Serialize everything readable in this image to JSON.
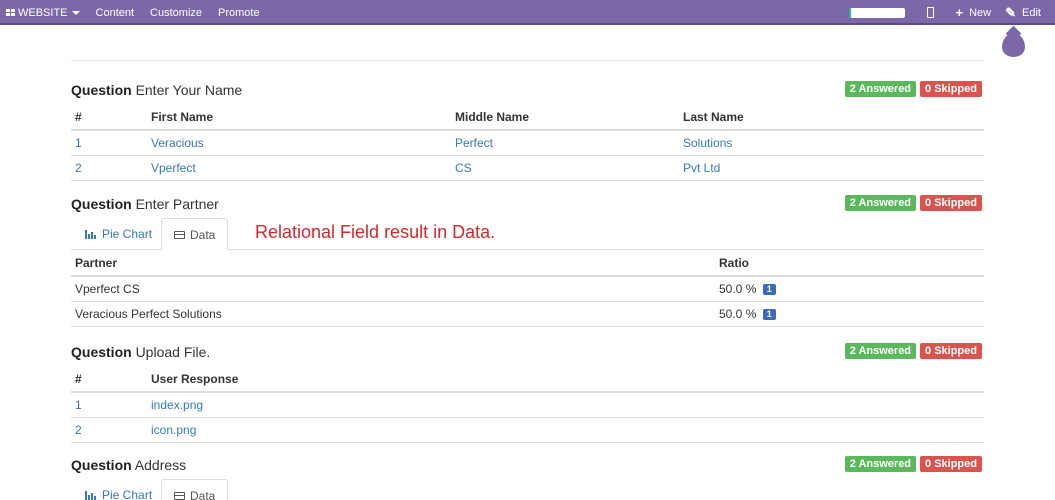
{
  "topbar": {
    "website_label": "WEBSITE",
    "menu": [
      "Content",
      "Customize",
      "Promote"
    ],
    "new_label": "New",
    "edit_label": "Edit",
    "progress_percent": 5
  },
  "questions": [
    {
      "prefix": "Question",
      "title": "Enter Your Name",
      "answered": "2 Answered",
      "skipped": "0 Skipped",
      "columns": [
        "#",
        "First Name",
        "Middle Name",
        "Last Name"
      ],
      "rows": [
        [
          "1",
          "Veracious",
          "Perfect",
          "Solutions"
        ],
        [
          "2",
          "Vperfect",
          "CS",
          "Pvt Ltd"
        ]
      ]
    },
    {
      "prefix": "Question",
      "title": "Enter Partner",
      "answered": "2 Answered",
      "skipped": "0 Skipped",
      "tabs": [
        "Pie Chart",
        "Data"
      ],
      "columns": [
        "Partner",
        "Ratio"
      ],
      "rows": [
        {
          "partner": "Vperfect CS",
          "ratio": "50.0 %",
          "count": "1"
        },
        {
          "partner": "Veracious Perfect Solutions",
          "ratio": "50.0 %",
          "count": "1"
        }
      ]
    },
    {
      "prefix": "Question",
      "title": "Upload File.",
      "answered": "2 Answered",
      "skipped": "0 Skipped",
      "columns": [
        "#",
        "User Response"
      ],
      "rows": [
        [
          "1",
          "index.png"
        ],
        [
          "2",
          "icon.png"
        ]
      ]
    },
    {
      "prefix": "Question",
      "title": "Address",
      "answered": "2 Answered",
      "skipped": "0 Skipped",
      "tabs": [
        "Pie Chart",
        "Data"
      ]
    }
  ],
  "annotation": "Relational Field result in Data.",
  "colors": {
    "navbar": "#7c68a8",
    "answered": "#5cb85c",
    "skipped": "#d9534f",
    "link": "#337ab7",
    "annotation": "#d9262c"
  }
}
